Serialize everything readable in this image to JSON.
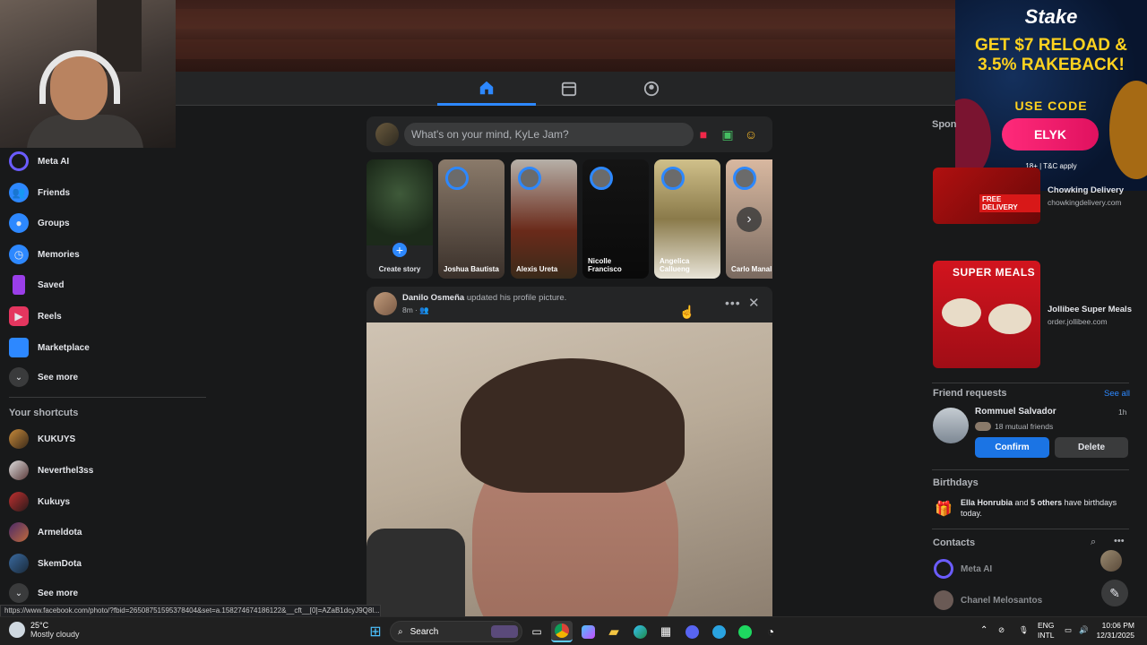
{
  "composer": {
    "placeholder": "What's on your mind, KyLe Jam?"
  },
  "sidebar": {
    "items": [
      {
        "label": "Meta AI",
        "icon": "meta-ai-icon",
        "color": "#6b5cff"
      },
      {
        "label": "Friends",
        "icon": "friends-icon",
        "color": "#2d88ff"
      },
      {
        "label": "Groups",
        "icon": "groups-icon",
        "color": "#2d88ff"
      },
      {
        "label": "Memories",
        "icon": "memories-icon",
        "color": "#2d88ff"
      },
      {
        "label": "Saved",
        "icon": "saved-icon",
        "color": "#9a3ee8"
      },
      {
        "label": "Reels",
        "icon": "reels-icon",
        "color": "#e4365f"
      },
      {
        "label": "Marketplace",
        "icon": "marketplace-icon",
        "color": "#2d88ff"
      },
      {
        "label": "See more",
        "icon": "chevron-down-icon",
        "color": "#3a3b3c"
      }
    ],
    "shortcuts_heading": "Your shortcuts",
    "shortcuts": [
      {
        "label": "KUKUYS"
      },
      {
        "label": "Neverthel3ss"
      },
      {
        "label": "Kukuys"
      },
      {
        "label": "Armeldota"
      },
      {
        "label": "SkemDota"
      },
      {
        "label": "See more"
      }
    ]
  },
  "stories": [
    {
      "name": "Create story"
    },
    {
      "name": "Joshua Bautista"
    },
    {
      "name": "Alexis Ureta"
    },
    {
      "name": "Nicolle Francisco"
    },
    {
      "name": "Angelica Callueng"
    },
    {
      "name": "Carlo Manal"
    }
  ],
  "post": {
    "author": "Danilo Osmeña",
    "action": "updated his profile picture.",
    "time": "8m ·"
  },
  "ad": {
    "brand": "Stake",
    "headline": "GET $7 RELOAD & 3.5% RAKEBACK!",
    "use_code": "USE CODE",
    "code": "ELYK",
    "terms": "18+ | T&C apply"
  },
  "right": {
    "sponsored": "Spon",
    "sponsored_ads": [
      {
        "title": "Chowking Delivery",
        "url": "chowkingdelivery.com",
        "banner_text": "FREE DELIVERY"
      },
      {
        "title": "Jollibee Super Meals",
        "url": "order.jollibee.com",
        "banner_text": "SUPER MEALS"
      }
    ],
    "friend_requests": {
      "heading": "Friend requests",
      "see_all": "See all",
      "name": "Rommuel Salvador",
      "time": "1h",
      "mutual": "18 mutual friends",
      "confirm": "Confirm",
      "delete": "Delete"
    },
    "birthdays": {
      "heading": "Birthdays",
      "name": "Ella Honrubia",
      "and": "and",
      "others": "5 others",
      "rest": "have birthdays today."
    },
    "contacts": {
      "heading": "Contacts",
      "items": [
        {
          "name": "Meta AI"
        },
        {
          "name": "Chanel Melosantos"
        }
      ]
    }
  },
  "status_url": "https://www.facebook.com/photo/?fbid=2650875159537840​4&set=a.158274674186122&__cft__[0]=AZaB1dcyJ9Q8l...",
  "taskbar": {
    "temp": "25°C",
    "weather": "Mostly cloudy",
    "search": "Search",
    "lang1": "ENG",
    "lang2": "INTL",
    "time": "10:06 PM",
    "date": "12/31/2025"
  }
}
